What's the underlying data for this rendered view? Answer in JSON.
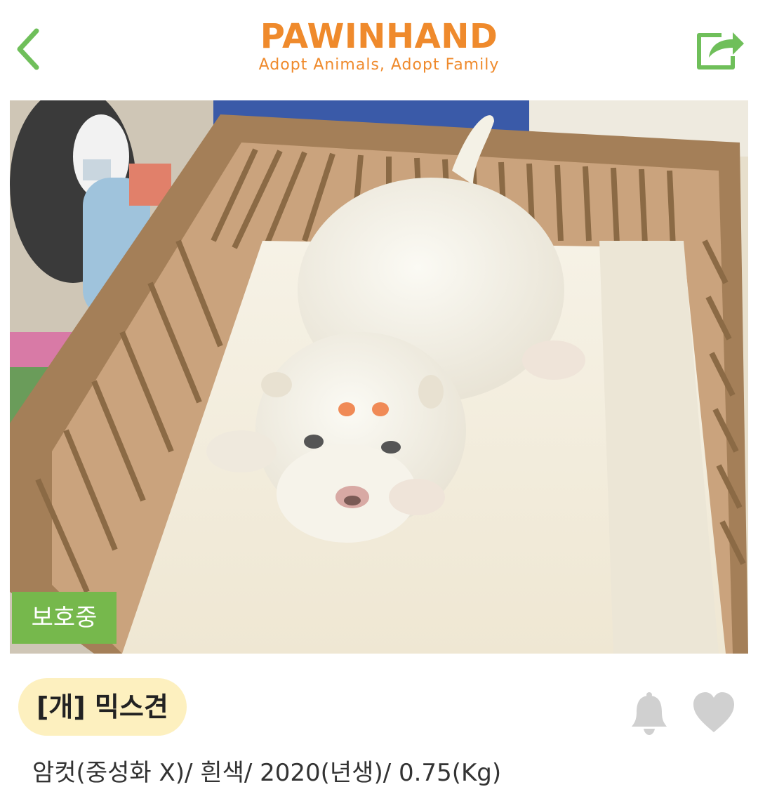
{
  "header": {
    "brand_title": "PAWINHAND",
    "brand_subtitle": "Adopt Animals, Adopt Family",
    "back_icon": "chevron-left-icon",
    "share_icon": "share-icon",
    "accent_color": "#ef8a2c",
    "icon_color": "#6fbf5a"
  },
  "photo": {
    "status_label": "보호중",
    "status_color": "#76b84c"
  },
  "animal": {
    "name": "[개] 믹스견",
    "details": "암컷(중성화 X)/ 흰색/ 2020(년생)/ 0.75(Kg)"
  },
  "actions": {
    "bell_icon": "bell-icon",
    "heart_icon": "heart-icon",
    "icon_color": "#d0d0d0"
  }
}
